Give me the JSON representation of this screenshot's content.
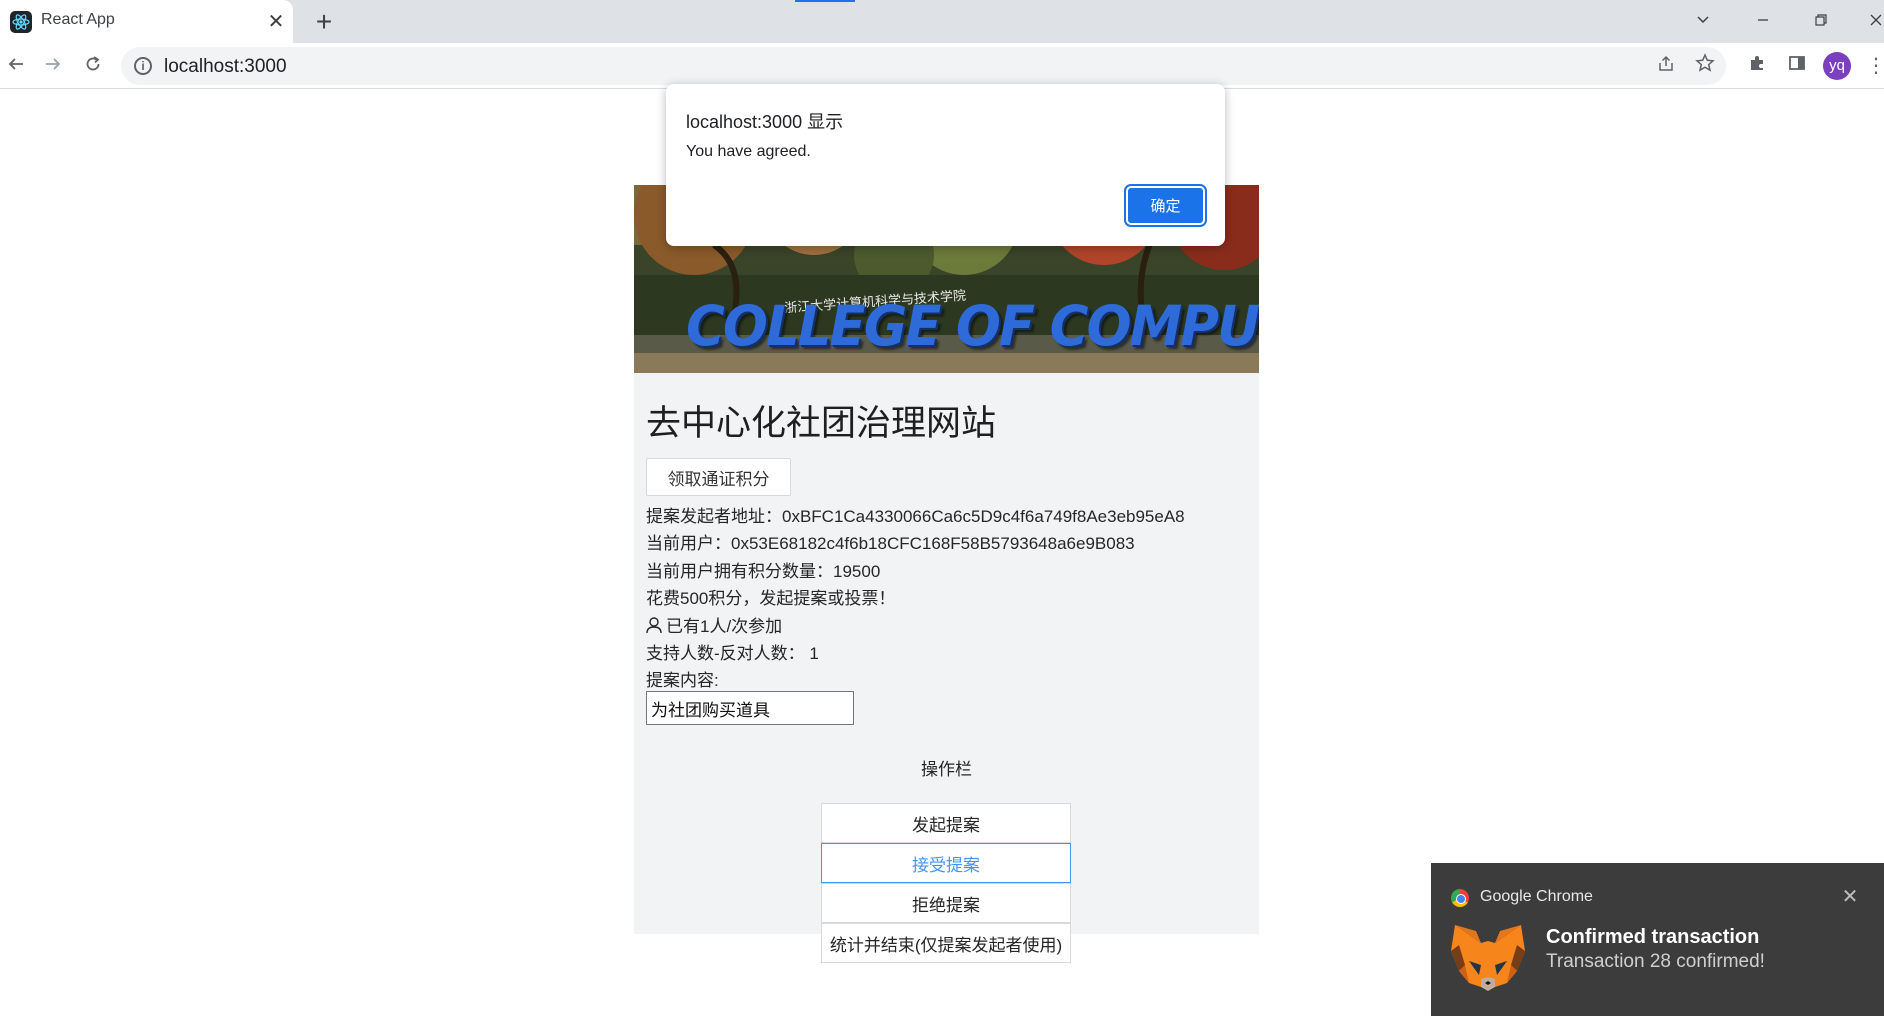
{
  "browser": {
    "tab_title": "React App",
    "tab_close": "✕",
    "new_tab": "+",
    "url": "localhost:3000",
    "profile_initials": "yq"
  },
  "app": {
    "banner_text": "COLLEGE OF COMPUTER SCIENCE",
    "banner_subtext": "浙江大学计算机科学与技术学院",
    "title": "去中心化社团治理网站",
    "claim_button": "领取通证积分",
    "info_lines": [
      "提案发起者地址：0xBFC1Ca4330066Ca6c5D9c4f6a749f8Ae3eb95eA8",
      "当前用户：0x53E68182c4f6b18CFC168F58B5793648a6e9B083",
      "当前用户拥有积分数量：19500",
      "花费500积分，发起提案或投票！",
      "已有1人/次参加",
      "支持人数-反对人数： 1",
      "提案内容:"
    ],
    "proposal_value": "为社团购买道具",
    "operations_title": "操作栏",
    "buttons": {
      "create": "发起提案",
      "accept": "接受提案",
      "reject": "拒绝提案",
      "finish": "统计并结束(仅提案发起者使用)"
    }
  },
  "alert": {
    "title": "localhost:3000 显示",
    "message": "You have agreed.",
    "ok_label": "确定"
  },
  "notification": {
    "app_name": "Google Chrome",
    "title": "Confirmed transaction",
    "body": "Transaction 28 confirmed!",
    "close": "✕"
  },
  "colors": {
    "accent": "#1a73e8",
    "active_button": "#4096ff",
    "card_bg": "#f2f3f5",
    "notification_bg": "#3c3c3c"
  }
}
